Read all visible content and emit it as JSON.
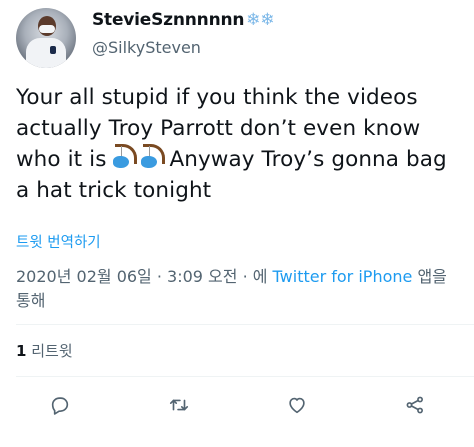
{
  "author": {
    "display_name": "StevieSznnnnnn",
    "display_name_emoji": "❄❄",
    "handle": "@SilkySteven"
  },
  "tweet": {
    "text_part1": "Your all stupid if you think the videos actually Troy Parrott don’t even know who it is ",
    "text_part2": "Anyway Troy’s gonna bag a hat trick tonight",
    "emojis": [
      "fishing-pole-icon",
      "fishing-pole-icon"
    ]
  },
  "translate_label": "트윗 번역하기",
  "meta": {
    "timestamp": "2020년 02월 06일 · 3:09 오전 · 에 ",
    "source": "Twitter for iPhone",
    "suffix": " 앱을 통해"
  },
  "stats": {
    "retweet_count": "1",
    "retweet_label": "리트윗"
  },
  "actions": {
    "reply": "reply-icon",
    "retweet": "retweet-icon",
    "like": "heart-icon",
    "share": "share-icon"
  },
  "colors": {
    "link": "#1d9bf0",
    "secondary_text": "#536471",
    "primary_text": "#0f1419"
  }
}
